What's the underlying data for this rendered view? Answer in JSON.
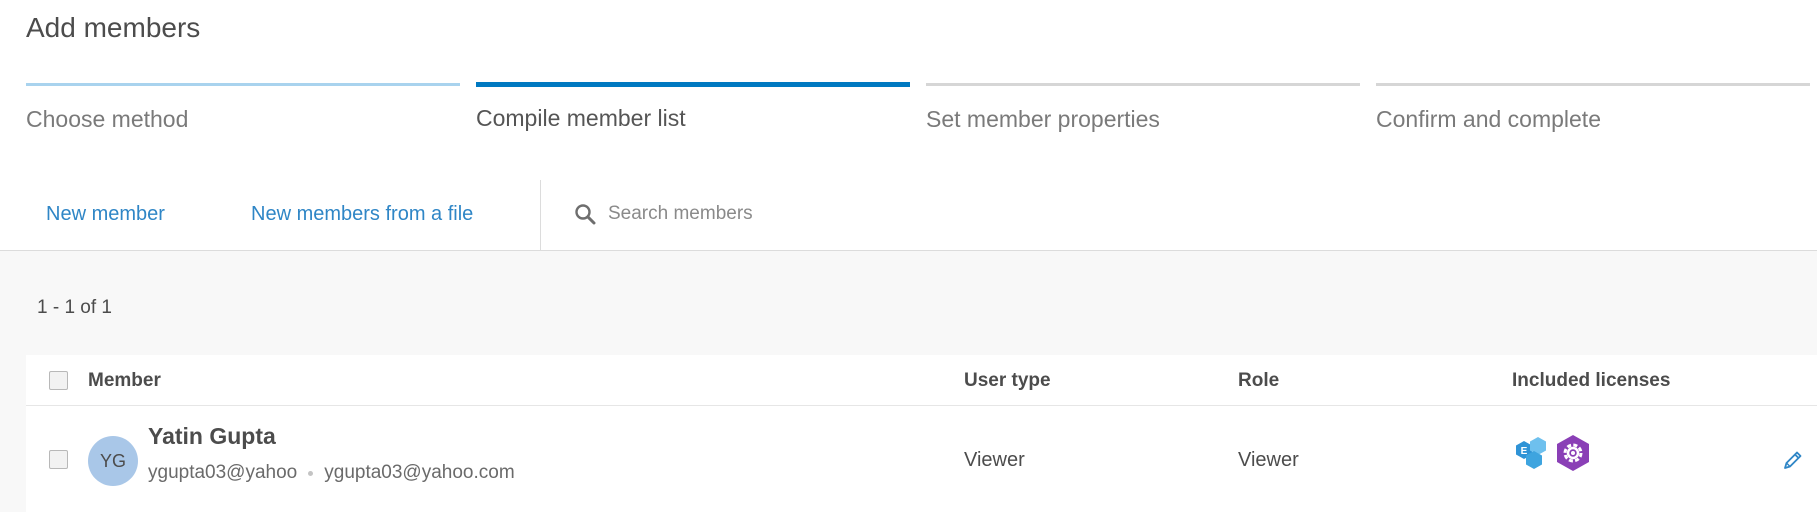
{
  "page": {
    "title": "Add members"
  },
  "steps": [
    {
      "label": "Choose method",
      "state": "done"
    },
    {
      "label": "Compile member list",
      "state": "active"
    },
    {
      "label": "Set member properties",
      "state": "todo"
    },
    {
      "label": "Confirm and complete",
      "state": "todo"
    }
  ],
  "actions": {
    "new_member": "New member",
    "new_members_from_file": "New members from a file"
  },
  "search": {
    "placeholder": "Search members",
    "value": "",
    "icon": "search-icon"
  },
  "list": {
    "range_text": "1 - 1 of 1",
    "columns": {
      "member": "Member",
      "user_type": "User type",
      "role": "Role",
      "licenses": "Included licenses"
    },
    "rows": [
      {
        "checked": false,
        "initials": "YG",
        "name": "Yatin Gupta",
        "username": "ygupta03@yahoo",
        "email": "ygupta03@yahoo.com",
        "user_type": "Viewer",
        "role": "Viewer",
        "licenses": [
          "esri-e-hexagon-icon",
          "gear-hexagon-icon"
        ],
        "edit_icon": "pencil-icon"
      }
    ]
  },
  "colors": {
    "accent": "#0079c1",
    "link": "#2f86c6",
    "step_done": "#a9d3ee",
    "license_blue": "#3ea4df",
    "license_purple": "#8a3fb6"
  }
}
